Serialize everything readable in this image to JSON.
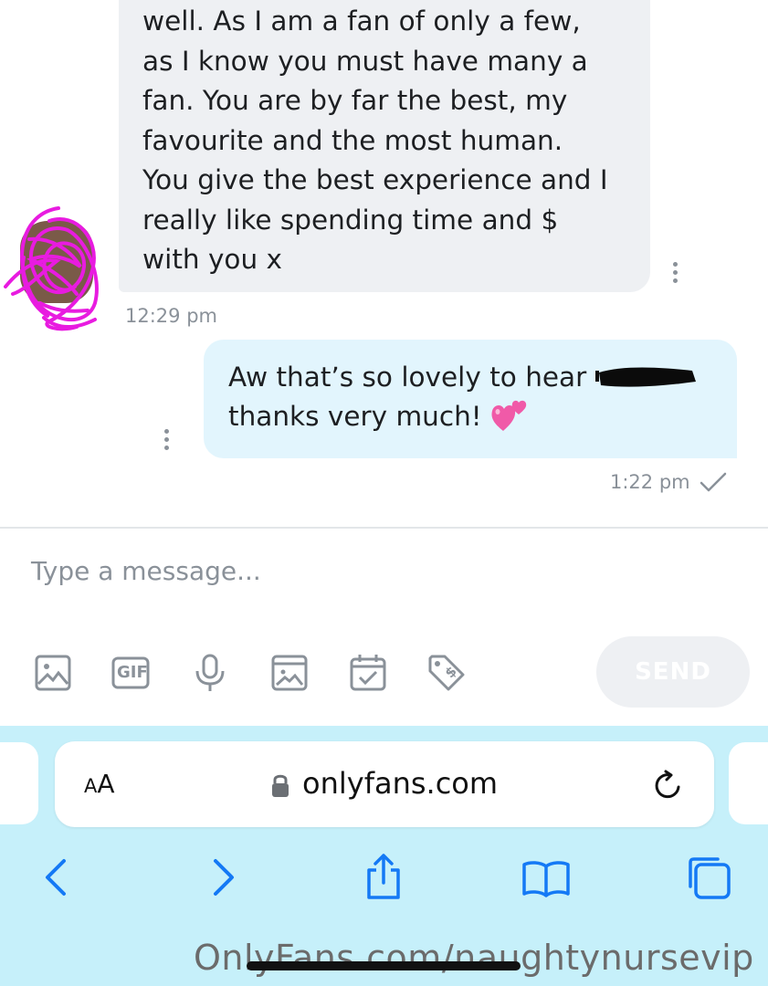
{
  "conversation": {
    "incoming": {
      "lines": [
        "well. As I am a fan of only a few,",
        "as I know you must have many a",
        "fan. You are by far the best, my",
        "favourite and the most human.",
        "You give the best experience and I",
        "really like spending time and $",
        "with you x"
      ],
      "time": "12:29 pm"
    },
    "outgoing": {
      "line1": "Aw that’s so lovely to hear",
      "line2": "thanks very much!",
      "time": "1:22 pm"
    }
  },
  "composer": {
    "placeholder": "Type a message...",
    "gif_label": "GIF",
    "send_label": "SEND",
    "tools": [
      "image-icon",
      "gif-icon",
      "microphone-icon",
      "vault-media-icon",
      "schedule-calendar-icon",
      "price-tag-icon"
    ]
  },
  "browser": {
    "text_size_label_small": "A",
    "text_size_label_large": "A",
    "url": "onlyfans.com",
    "nav": [
      "back-icon",
      "forward-icon",
      "share-icon",
      "bookmarks-icon",
      "tabs-icon"
    ]
  },
  "watermark": "OnlyFans.com/naughtynursevip",
  "colors": {
    "incoming_bubble": "#eef0f3",
    "outgoing_bubble": "#e2f5fd",
    "browser_bar": "#c6f0fa",
    "ios_blue": "#1479f5",
    "avatar_scribble": "#e81be0"
  }
}
